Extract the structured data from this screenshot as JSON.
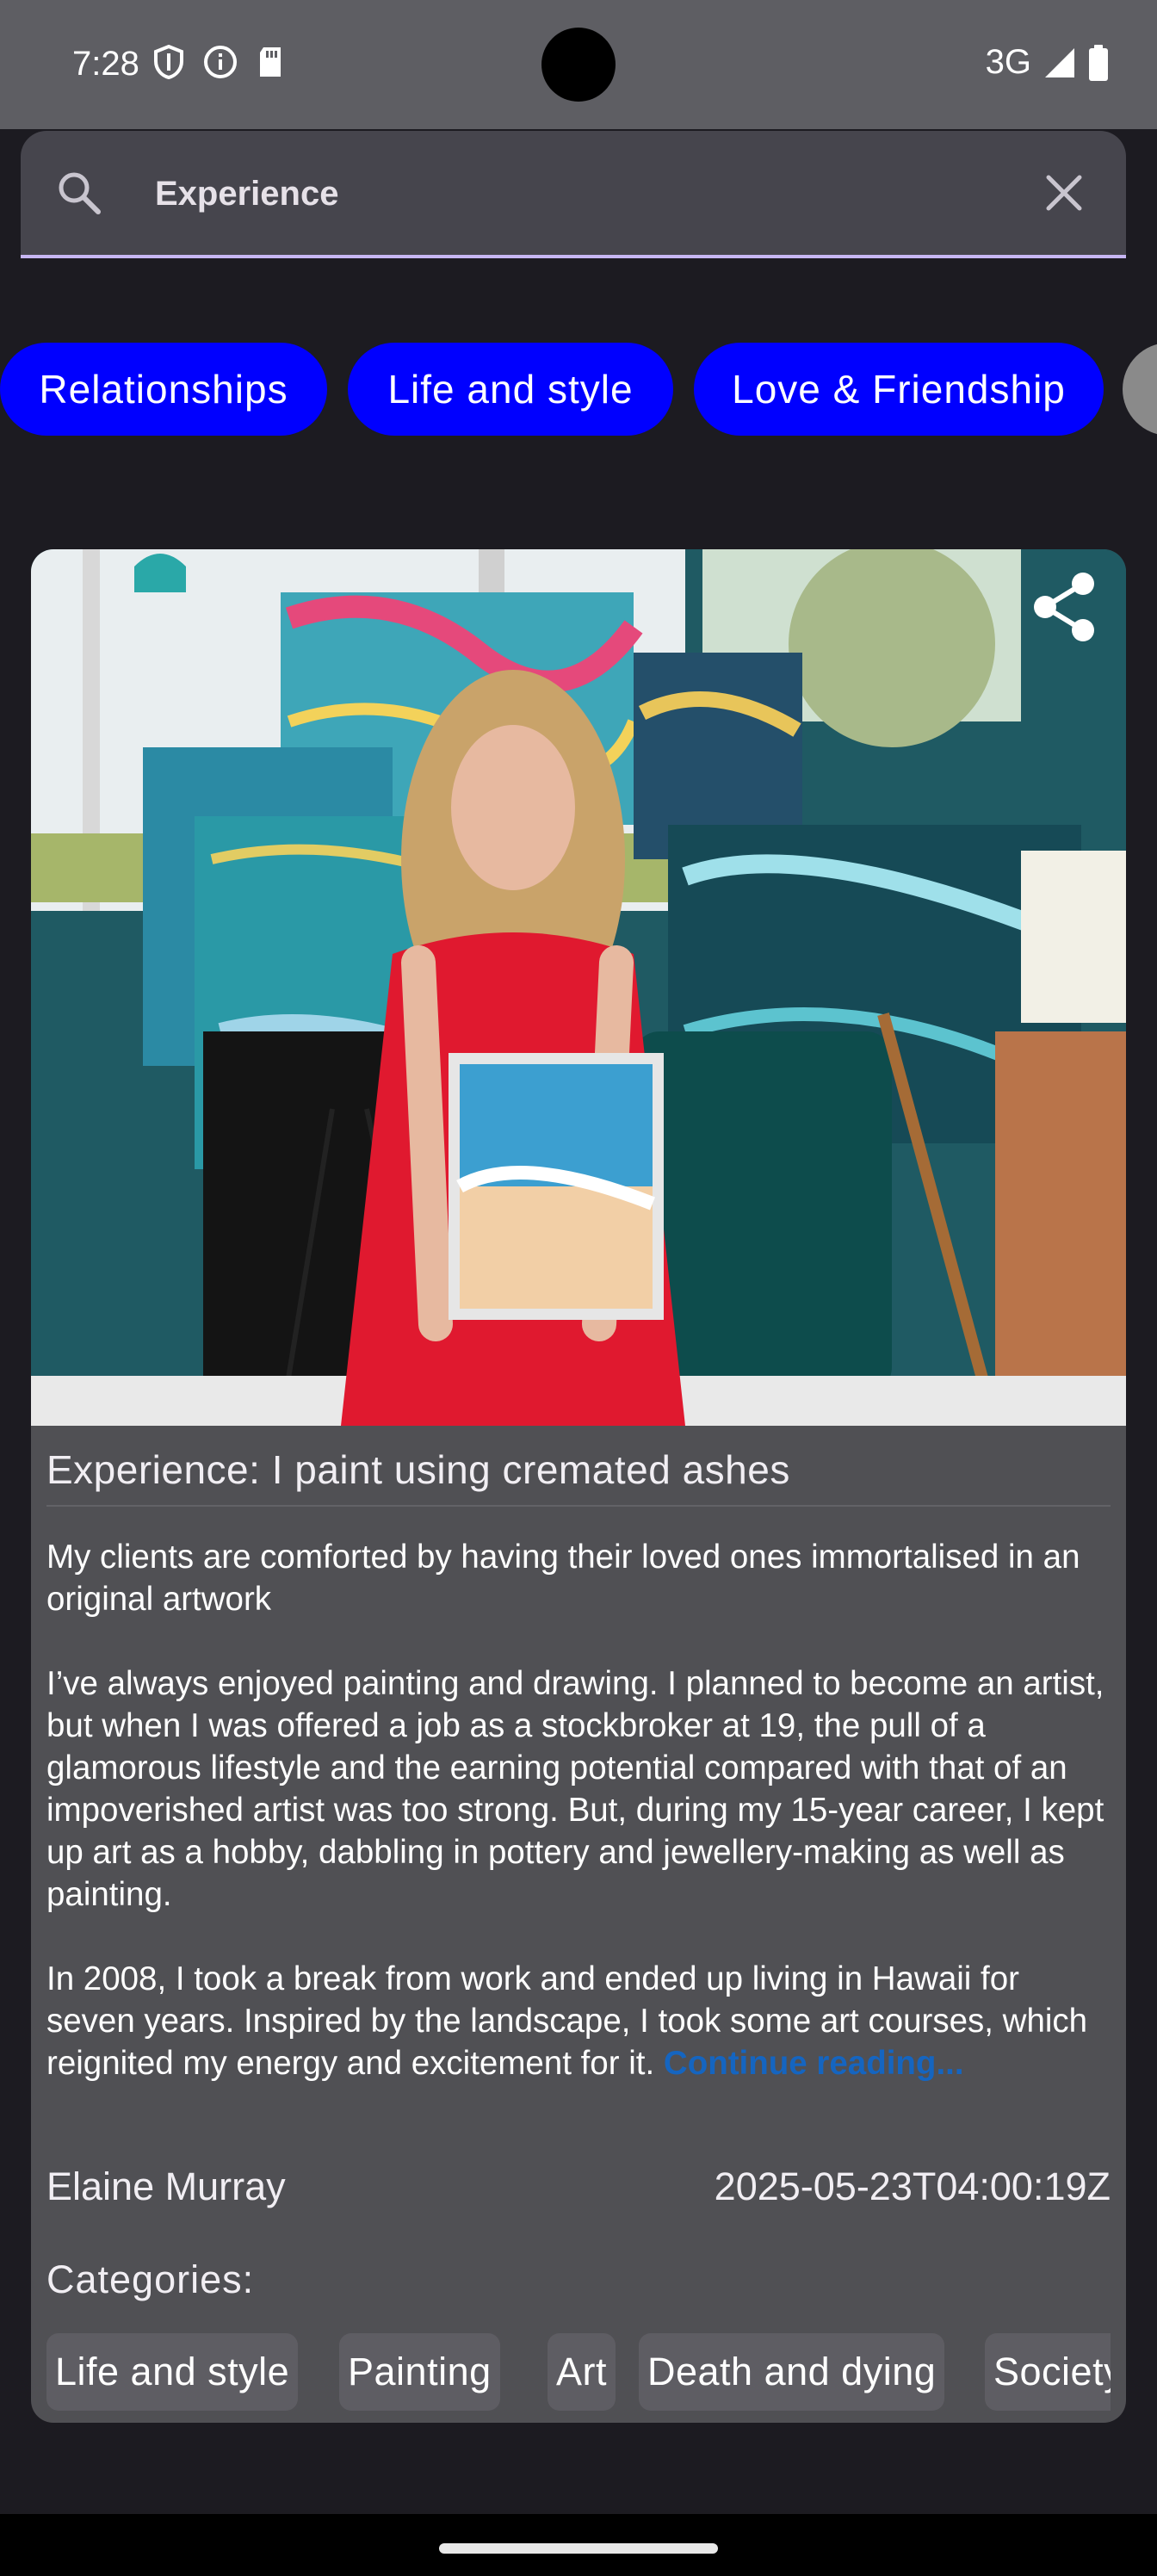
{
  "status_bar": {
    "time": "7:28",
    "network": "3G",
    "icons_left": [
      "shield-icon",
      "info-icon",
      "sd-card-icon"
    ],
    "icons_right": [
      "signal-icon",
      "battery-icon"
    ]
  },
  "search": {
    "value": "Experience",
    "icon": "search-icon",
    "clear_icon": "close-icon"
  },
  "filter_chips": [
    {
      "label": "Relationships"
    },
    {
      "label": "Life and style"
    },
    {
      "label": "Love & Friendship"
    },
    {
      "label": ""
    }
  ],
  "article": {
    "image_alt": "Woman in red dress holding a small painting in front of colorful abstract paintings",
    "share_icon": "share-icon",
    "title": "Experience: I paint using cremated ashes",
    "standfirst": "My clients are comforted by having their loved ones immortalised in an original artwork",
    "paragraph_1": "I’ve always enjoyed painting and drawing. I planned to become an artist, but when I was offered a job as a stockbroker at 19, the pull of a glamorous lifestyle and the earning potential compared with that of an impoverished artist was too strong. But, during my 15-year career, I kept up art as a hobby, dabbling in pottery and jewellery-making as well as painting.",
    "paragraph_2": "In 2008, I took a break from work and ended up living in Hawaii for seven years. Inspired by the landscape, I took some art courses, which reignited my energy and excitement for it.",
    "continue_label": "Continue reading...",
    "author": "Elaine Murray",
    "date": "2025-05-23T04:00:19Z",
    "categories_label": "Categories:",
    "categories": [
      "Life and style",
      "Painting",
      "Art",
      "Death and dying",
      "Society"
    ]
  },
  "colors": {
    "chip_blue": "#0000ff",
    "link_blue": "#1565c0",
    "card_bg": "#505054",
    "search_underline": "#c7b6f3"
  }
}
